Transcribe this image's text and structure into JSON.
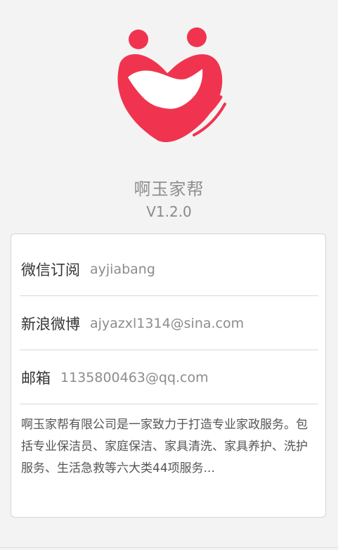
{
  "app": {
    "name": "啊玉家帮",
    "version": "V1.2.0"
  },
  "contacts": [
    {
      "label": "微信订阅",
      "value": "ayjiabang"
    },
    {
      "label": "新浪微博",
      "value": "ajyazxl1314@sina.com"
    },
    {
      "label": "邮箱",
      "value": "1135800463@qq.com"
    }
  ],
  "description": "啊玉家帮有限公司是一家致力于打造专业家政服务。包括专业保洁员、家庭保洁、家具清洗、家具养护、洗护服务、生活急救等六大类44项服务...",
  "colors": {
    "brand": "#f0344f",
    "background": "#f3f3f3"
  },
  "icons": {
    "logo": "heart-hands-logo"
  }
}
